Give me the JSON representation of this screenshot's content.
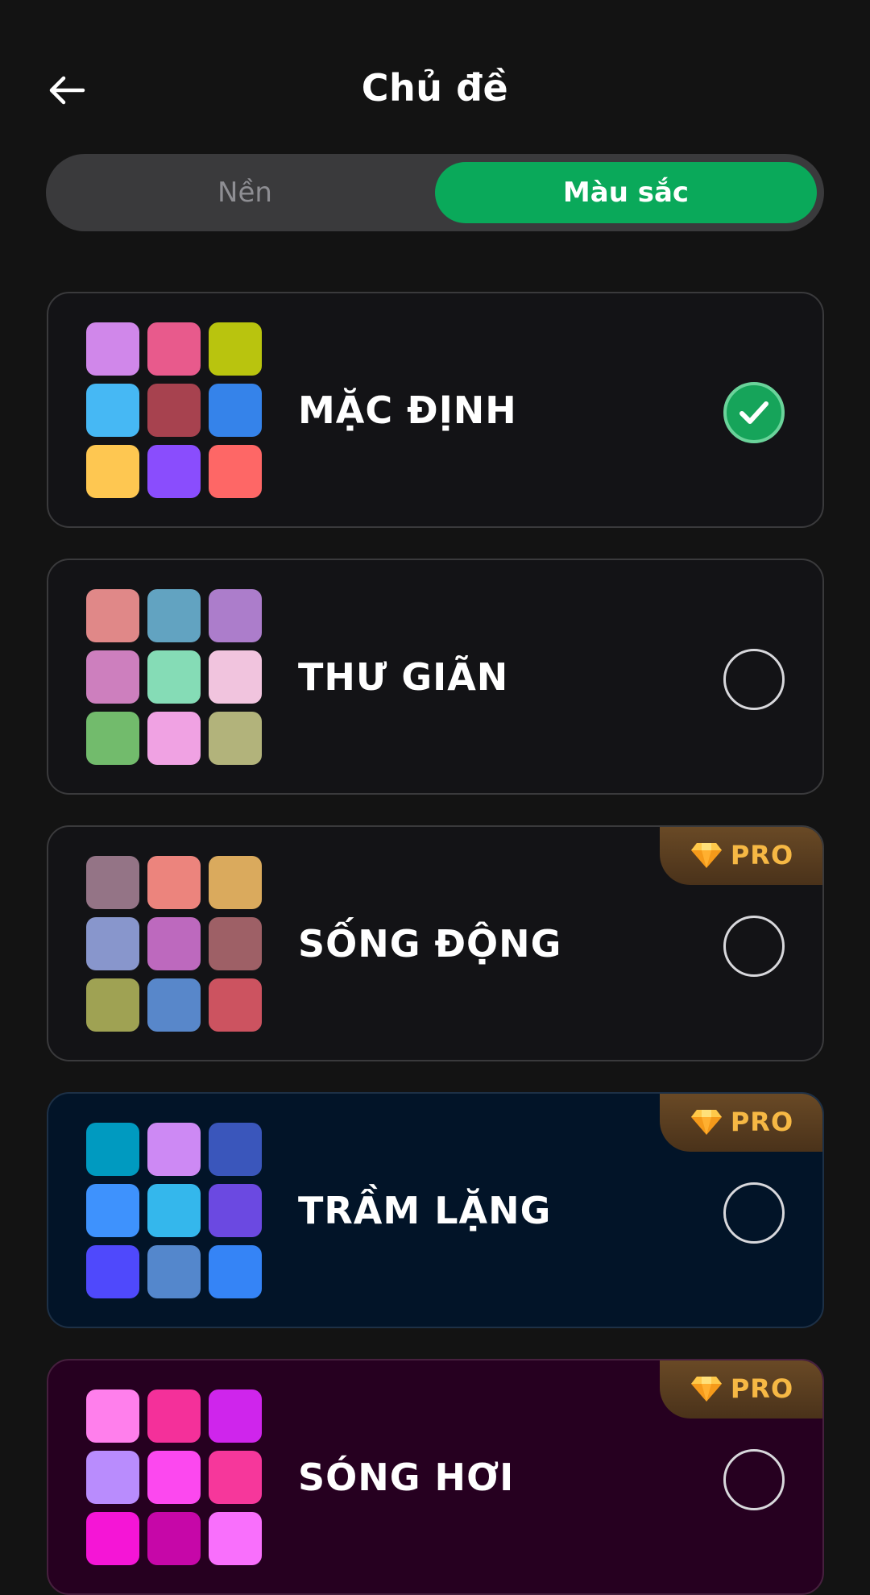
{
  "header": {
    "title": "Chủ đề",
    "back_icon": "arrow-left-icon"
  },
  "tabs": [
    {
      "label": "Nền",
      "selected": false
    },
    {
      "label": "Màu sắc",
      "selected": true
    }
  ],
  "colors": {
    "accent": "#0aa95a",
    "background": "#131313",
    "pro_text": "#f6b844"
  },
  "themes": [
    {
      "name": "MẶC ĐỊNH",
      "selected": true,
      "pro": false,
      "pro_label": "",
      "background": "#131316",
      "border": "#3a3a3c",
      "swatches": [
        "#d087ea",
        "#e85a8c",
        "#b9c40e",
        "#46b8f4",
        "#a7424f",
        "#3583ea",
        "#fec751",
        "#8a4dfd",
        "#fe6766"
      ]
    },
    {
      "name": "THƯ GIÃN",
      "selected": false,
      "pro": false,
      "pro_label": "",
      "background": "#131316",
      "border": "#3a3a3c",
      "swatches": [
        "#e08888",
        "#62a3c1",
        "#ac7dcb",
        "#cd7fbe",
        "#85dcb6",
        "#f1c4de",
        "#72bb6c",
        "#f0a2e3",
        "#b2b37b"
      ]
    },
    {
      "name": "SỐNG ĐỘNG",
      "selected": false,
      "pro": true,
      "pro_label": "PRO",
      "background": "#131316",
      "border": "#3a3a3c",
      "swatches": [
        "#947486",
        "#ec847d",
        "#daaa5d",
        "#8896cc",
        "#bd69be",
        "#9e6066",
        "#9fa253",
        "#5887ca",
        "#cc5360"
      ]
    },
    {
      "name": "TRẦM LẶNG",
      "selected": false,
      "pro": true,
      "pro_label": "PRO",
      "background": "#021428",
      "border": "#1d3046",
      "swatches": [
        "#009ac0",
        "#cd89f4",
        "#3a56bb",
        "#3e92fd",
        "#34b7ec",
        "#6b49e1",
        "#4f49fc",
        "#5487cc",
        "#3584f6"
      ]
    },
    {
      "name": "SÓNG HƠI",
      "selected": false,
      "pro": true,
      "pro_label": "PRO",
      "background": "#260020",
      "border": "#46203e",
      "swatches": [
        "#ff7fec",
        "#f4309a",
        "#cf25ec",
        "#b98cfd",
        "#fc48ef",
        "#f6379b",
        "#f515d6",
        "#c607a8",
        "#f96ffc"
      ]
    }
  ]
}
